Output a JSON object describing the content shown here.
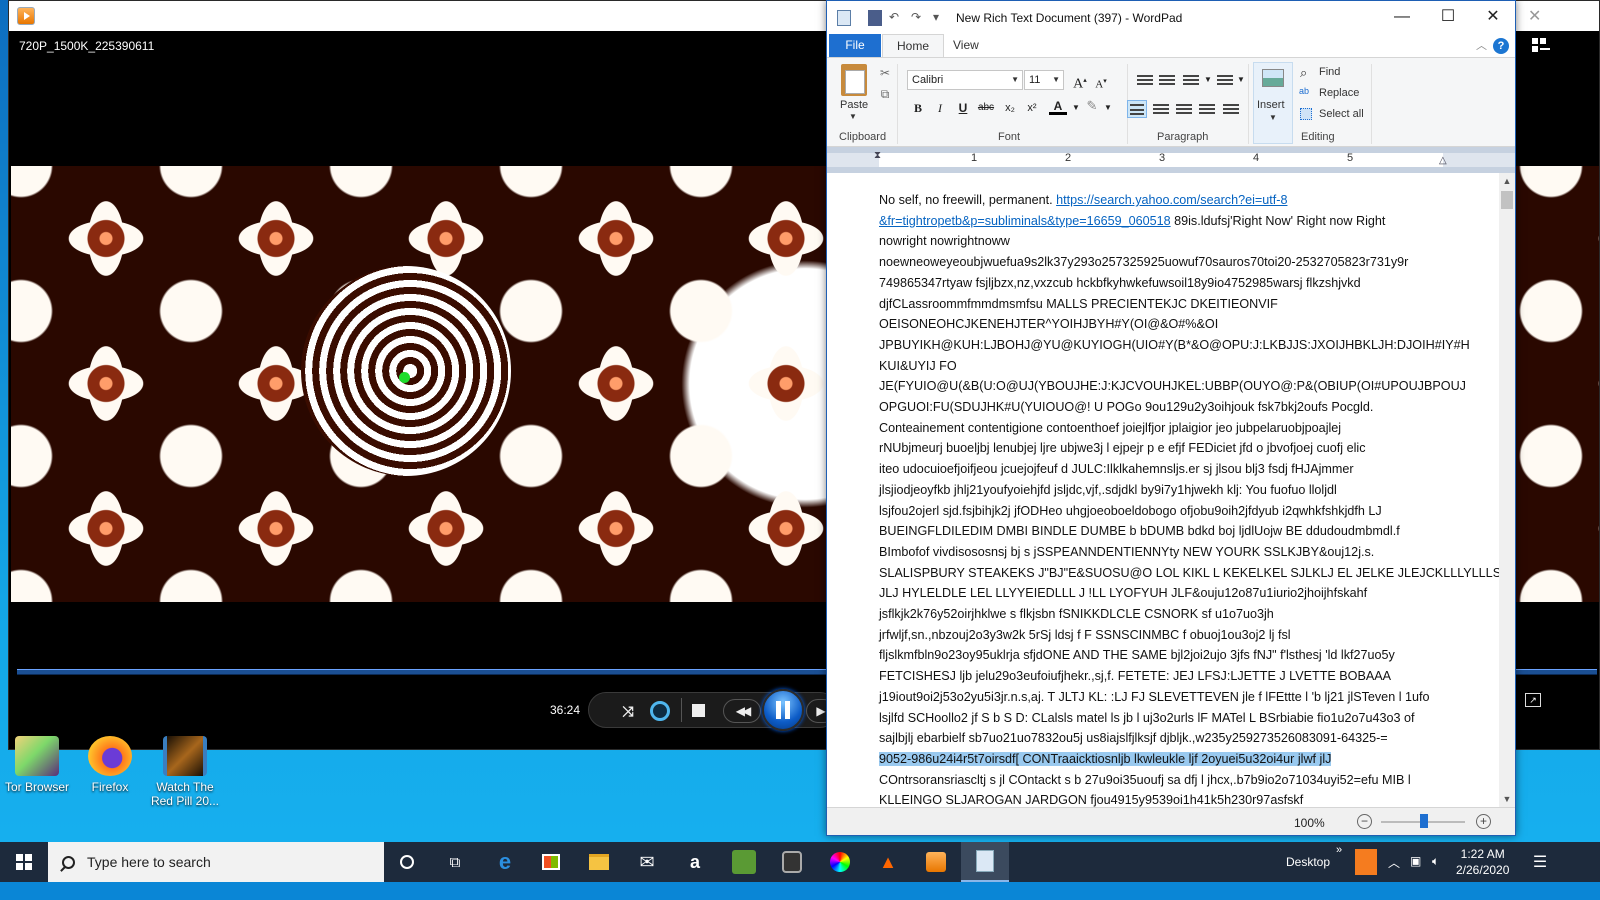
{
  "media_player": {
    "file_name": "720P_1500K_225390611",
    "elapsed_time": "36:24",
    "app_icon": "media-player-icon",
    "controls": [
      "shuffle-icon",
      "repeat-icon",
      "stop-icon",
      "previous-icon",
      "pause-icon",
      "next-icon"
    ],
    "close_label": "✕"
  },
  "desktop": {
    "icons": [
      {
        "label": "Tor Browser",
        "icon": "tor-browser-icon"
      },
      {
        "label": "Firefox",
        "icon": "firefox-icon"
      },
      {
        "label": "Watch The Red Pill 20...",
        "icon": "video-file-icon"
      }
    ]
  },
  "wordpad": {
    "title": "New Rich Text Document (397) - WordPad",
    "window_controls": {
      "minimize": "—",
      "maximize": "☐",
      "close": "✕"
    },
    "tabs": [
      {
        "label": "File"
      },
      {
        "label": "Home"
      },
      {
        "label": "View"
      }
    ],
    "active_tab": "Home",
    "help_label": "?",
    "ribbon": {
      "clipboard": {
        "group_label": "Clipboard",
        "paste_label": "Paste"
      },
      "font": {
        "group_label": "Font",
        "font_family": "Calibri",
        "font_size": "11"
      },
      "paragraph": {
        "group_label": "Paragraph"
      },
      "insert": {
        "label": "Insert"
      },
      "editing": {
        "group_label": "Editing",
        "find": "Find",
        "replace": "Replace",
        "select_all": "Select all"
      }
    },
    "ruler": {
      "numbers": [
        "1",
        "2",
        "3",
        "4",
        "5"
      ]
    },
    "document": {
      "lines": [
        {
          "text": "No self, no freewill, permanent. ",
          "link": "https://search.yahoo.com/search?ei=utf-8"
        },
        {
          "link": "&fr=tightropetb&p=subliminals&type=16659_060518",
          "text": " 89is.ldufsj'Right Now' Right now Right"
        },
        {
          "text": "nowright nowrightnoww"
        },
        {
          "text": "noewneoweyeoubjwuefua9s2lk37y293o257325925uowuf70sauros70toi20-2532705823r731y9r"
        },
        {
          "text": "749865347rtyaw fsjljbzx,nz,vxzcub hckbfkyhwkefuwsoil18y9io4752985warsj flkzshjvkd"
        },
        {
          "text": "djfCLassroommfmmdmsmfsu MALLS PRECIENTEKJC DKEITIEONVIF"
        },
        {
          "text": "OEISONEOHCJKENEHJTER^YOIHJBYH#Y(OI@&O#%&OI"
        },
        {
          "text": "JPBUYIKH@KUH:LJBOHJ@YU@KUYIOGH(UIO#Y(B*&O@OPU:J:LKBJJS:JXOIJHBKLJH:DJOIH#IY#H"
        },
        {
          "text": "KUI&UYIJ FO"
        },
        {
          "text": "JE(FYUIO@U(&B(U:O@UJ(YBOUJHE:J:KJCVOUHJKEL:UBBP(OUYO@:P&(OBIUP(OI#UPOUJBPOUJ"
        },
        {
          "text": "OPGUOI:FU(SDUJHK#U(YUIOUO@! U POGo 9ou129u2y3oihjouk fsk7bkj2oufs Pocgld."
        },
        {
          "text": "Conteainement contentigione contoenthoef joiejlfjor jplaigior jeo jubpelaruobjpoajlej"
        },
        {
          "text": "rNUbjmeurj buoeljbj lenubjej ljre ubjwe3j l ejpejr p e efjf FEDiciet jfd o jbvofjoej cuofj elic"
        },
        {
          "text": "iteo udocuioefjoifjeou jcuejojfeuf d JULC:Ilklkahemnsljs.er sj jlsou blj3 fsdj fHJAjmmer"
        },
        {
          "text": "jlsjiodjeoyfkb jhlj21youfyoiehjfd jsljdc,vjf,.sdjdkl by9i7y1hjwekh klj: You fuofuo lloljdl"
        },
        {
          "text": "lsjfou2ojerl sjd.fsjbihjk2j jfODHeo uhgjoeoboeldobogo ofjobu9oih2jfdyub i2qwhkfshkjdfh LJ"
        },
        {
          "text": "BUEINGFLDILEDIM DMBI BINDLE DUMBE b bDUMB bdkd boj ljdlUojw BE ddudoudmbmdl.f"
        },
        {
          "text": "BImbofof vivdisososnsj bj s jSSPEANNDENTIENNYty NEW YOURK SSLKJBY&ouj12j.s."
        },
        {
          "text": "SLALISPBURY STEAKEKS J\"BJ\"E&SUOSU@O LOL KIKL L KEKELKEL SJLKLJ EL JELKE JLEJCKLLLYLLLS"
        },
        {
          "text": "JLJ HYLELDLE LEL LLYYEIEDLLL J !LL LYOFYUH JLF&ouju12o87u1iurio2jhoijhfskahf"
        },
        {
          "text": "jsflkjk2k76y52oirjhklwe s flkjsbn fSNIKKDLCLE CSNORK sf u1o7uo3jh"
        },
        {
          "text": "jrfwljf,sn.,nbzouj2o3y3w2k 5rSj ldsj f F SSNSCINMBC f obuoj1ou3oj2 lj fsl"
        },
        {
          "text": "fljslkmfbln9o23oy95uklrja sfjdONE AND THE SAME bjl2joi2ujo 3jfs fNJ\" f'lsthesj 'ld lkf27uo5y"
        },
        {
          "text": "FETCISHESJ ljb jelu29o3eufoiufjhekr.,sj,f. FETETE: JEJ LFSJ:LJETTE J LVETTE BOBAAA"
        },
        {
          "text": "j19iout9oi2j53o2yu5i3jr.n.s,aj. T JLTJ KL: :LJ FJ SLEVETTEVEN jle f lFEttte l 'b lj21 jlSTeven l 1ufo"
        },
        {
          "text": "lsjlfd SCHoollo2 jf S b S D: CLalsls matel ls jb l uj3o2urls lF MATel L BSrbiabie fio1u2o7u43o3 of"
        },
        {
          "text": "sajlbjlj ebarbielf sb7uo21uo7832ou5j us8iajslfjlksjf djbljk.,w235y259273526083091-64325-="
        },
        {
          "text": "9052-986u24i4r5t7oirsdf[ CONTraaicktiosnljb lkwleukle ljf 2oyuei5u32oi4ur jlwf jlJ",
          "selected": true
        },
        {
          "text": "COntrsoransriascltj s jl COntackt s b 27u9oi35uoufj sa dfj l jhcx,.b7b9io2o71034uyi52=efu MIB l"
        },
        {
          "text": "KLLEINGO SLJAROGAN JARDGON fjou4915y9539oi1h41k5h230r97asfskf"
        }
      ]
    },
    "status_bar": {
      "zoom_level": "100%",
      "zoom_value_percent": 100
    }
  },
  "taskbar": {
    "search_placeholder": "Type here to search",
    "pinned": [
      "cortana-icon",
      "task-view-icon",
      "edge-icon",
      "store-icon",
      "file-explorer-icon",
      "mail-icon",
      "amazon-icon",
      "tripadvisor-icon",
      "camera-app-icon",
      "color-app-icon",
      "vlc-icon",
      "media-player-icon",
      "wordpad-icon"
    ],
    "amazon_glyph": "a",
    "desktop_label": "Desktop",
    "toolbar_chevron": "»",
    "time": "1:22 AM",
    "date": "2/26/2020"
  }
}
